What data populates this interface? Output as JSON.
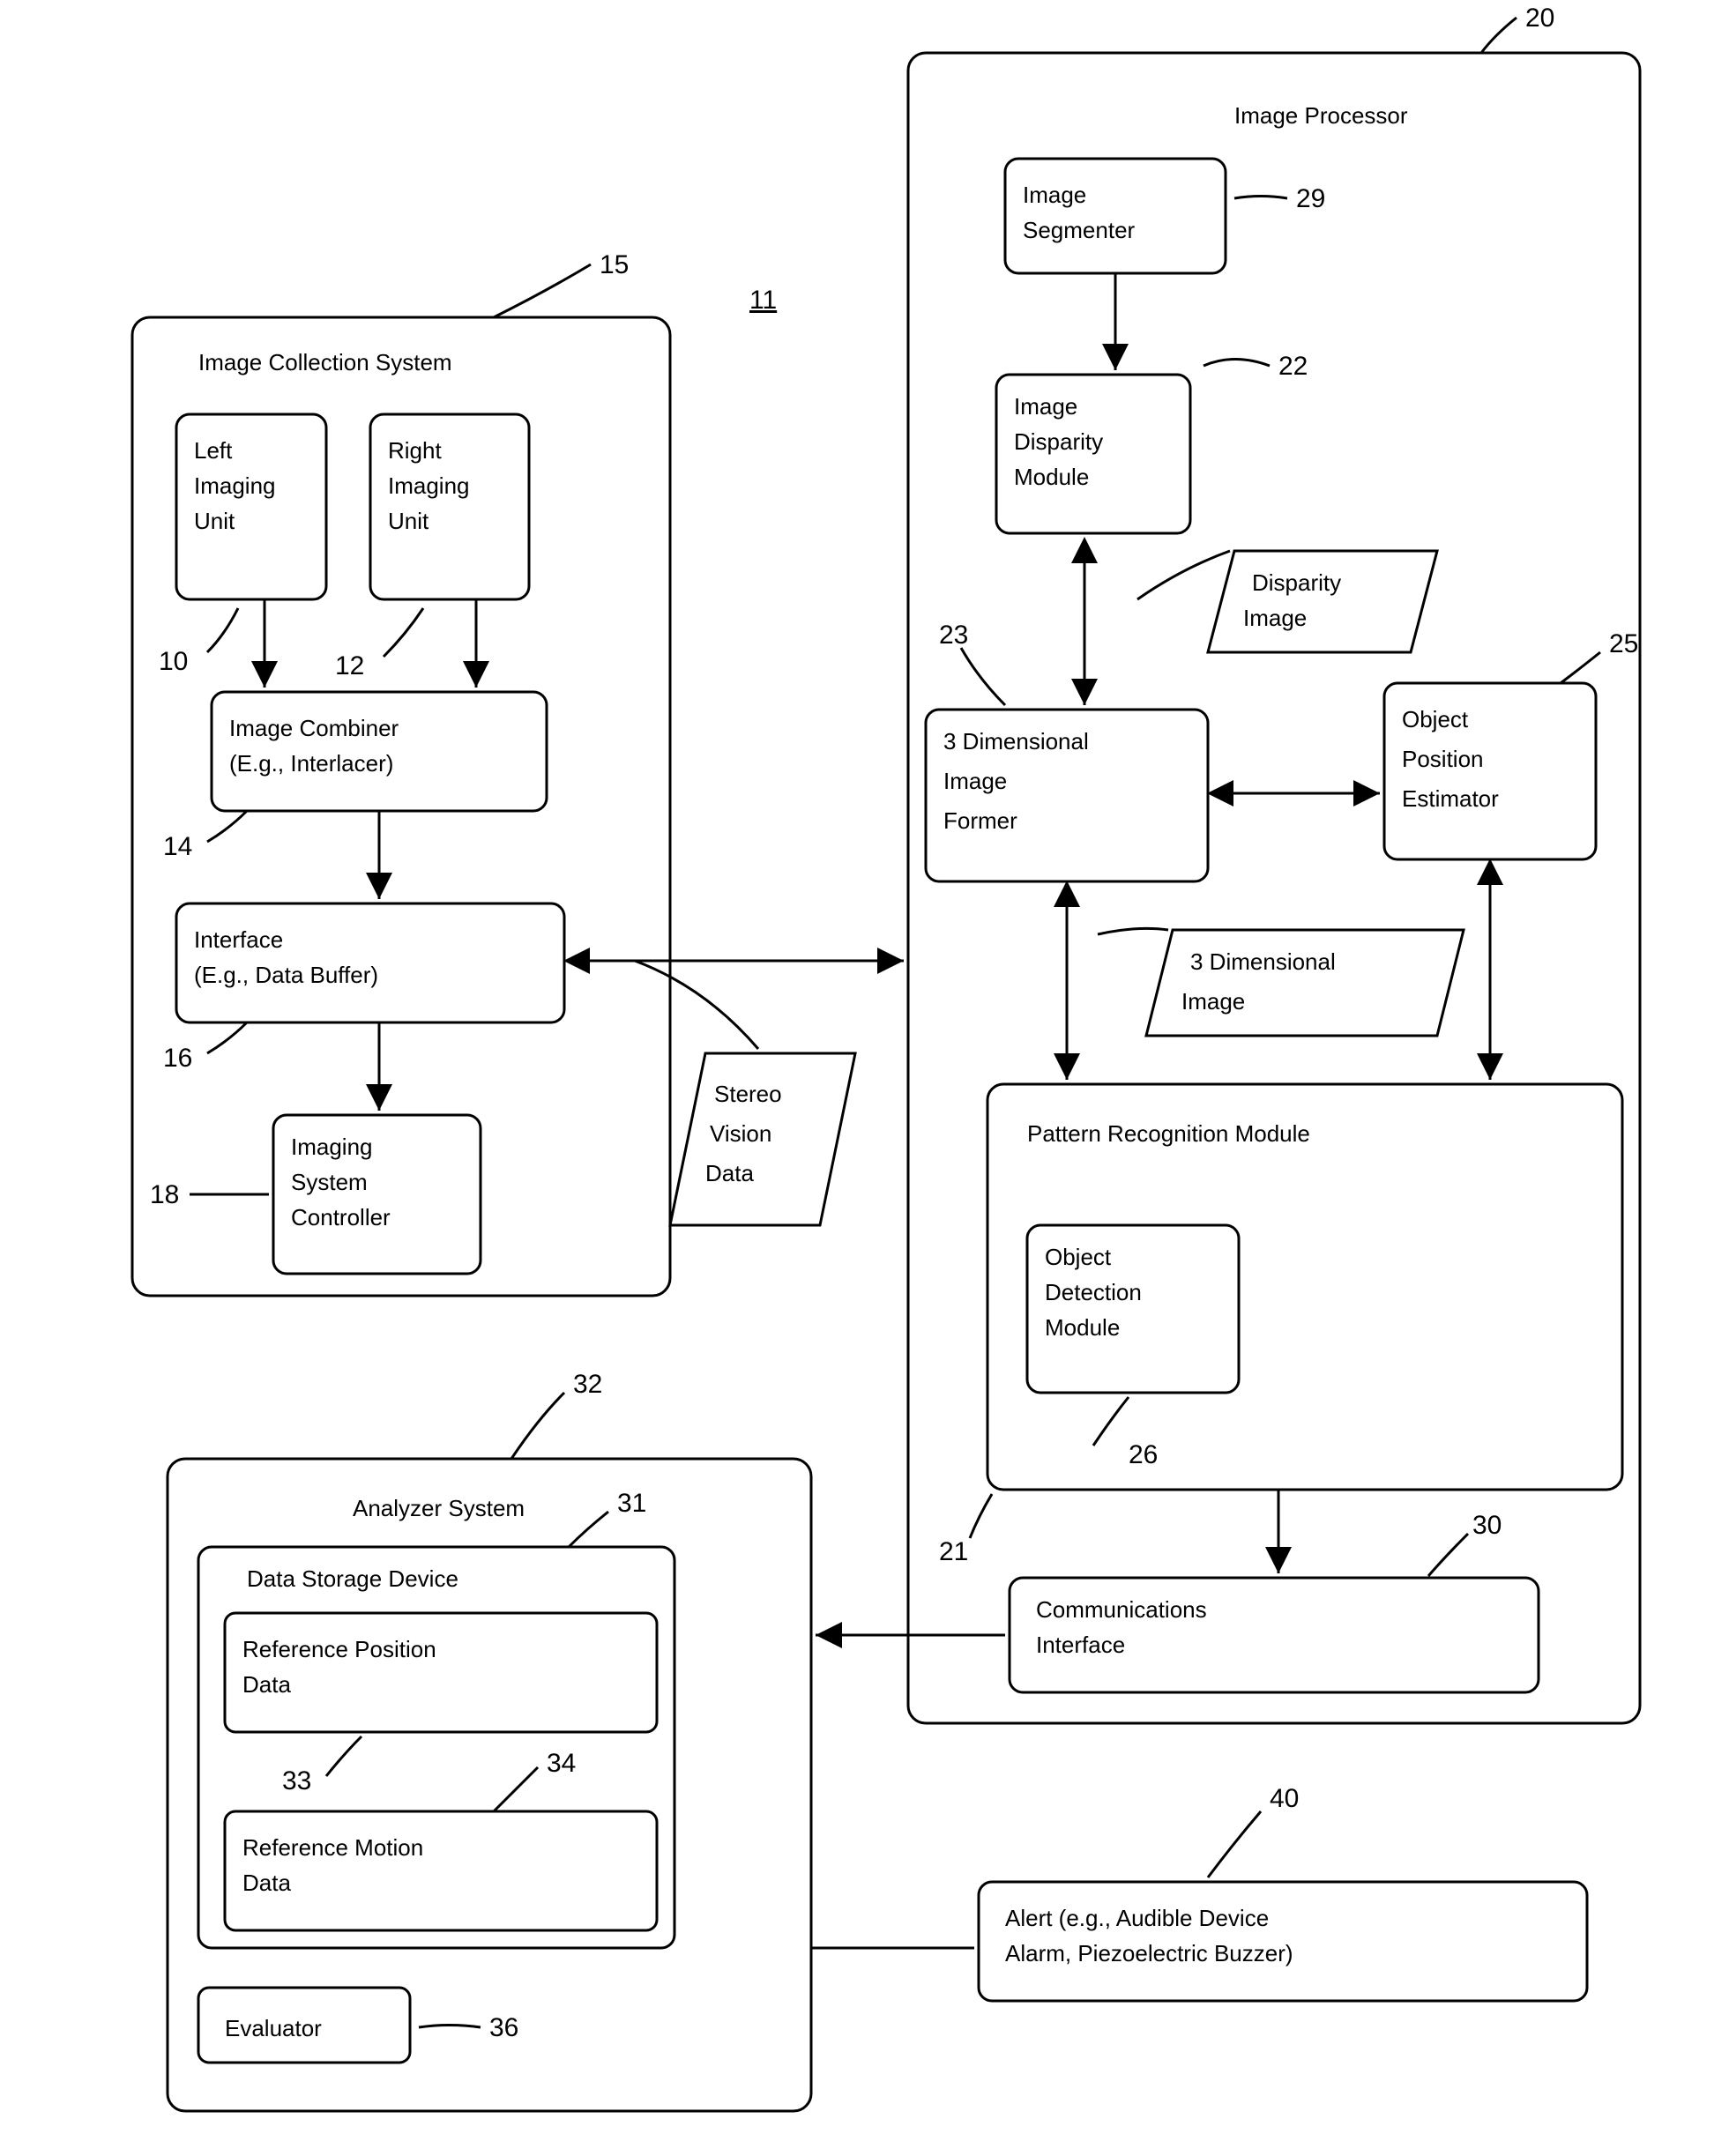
{
  "refs": {
    "r11": "11",
    "r15": "15",
    "r10": "10",
    "r12": "12",
    "r14": "14",
    "r16": "16",
    "r18": "18",
    "r20": "20",
    "r29": "29",
    "r22": "22",
    "r23": "23",
    "r25": "25",
    "r26": "26",
    "r21": "21",
    "r30": "30",
    "r31": "31",
    "r32": "32",
    "r33": "33",
    "r34": "34",
    "r36": "36",
    "r40": "40"
  },
  "labels": {
    "image_collection_system": "Image Collection System",
    "left_imaging_unit_l1": "Left",
    "left_imaging_unit_l2": "Imaging",
    "left_imaging_unit_l3": "Unit",
    "right_imaging_unit_l1": "Right",
    "right_imaging_unit_l2": "Imaging",
    "right_imaging_unit_l3": "Unit",
    "image_combiner_l1": "Image Combiner",
    "image_combiner_l2": "(E.g., Interlacer)",
    "interface_l1": "Interface",
    "interface_l2": "(E.g., Data Buffer)",
    "imaging_controller_l1": "Imaging",
    "imaging_controller_l2": "System",
    "imaging_controller_l3": "Controller",
    "stereo_vision_l1": "Stereo",
    "stereo_vision_l2": "Vision",
    "stereo_vision_l3": "Data",
    "image_processor": "Image Processor",
    "image_segmenter_l1": "Image",
    "image_segmenter_l2": "Segmenter",
    "image_disparity_l1": "Image",
    "image_disparity_l2": "Disparity",
    "image_disparity_l3": "Module",
    "disparity_image_l1": "Disparity",
    "disparity_image_l2": "Image",
    "three_d_former_l1": "3 Dimensional",
    "three_d_former_l2": "Image",
    "three_d_former_l3": "Former",
    "obj_pos_est_l1": "Object",
    "obj_pos_est_l2": "Position",
    "obj_pos_est_l3": "Estimator",
    "three_d_image_l1": "3 Dimensional",
    "three_d_image_l2": "Image",
    "pattern_recog": "Pattern Recognition Module",
    "obj_det_l1": "Object",
    "obj_det_l2": "Detection",
    "obj_det_l3": "Module",
    "comm_iface_l1": "Communications",
    "comm_iface_l2": "Interface",
    "analyzer_system": "Analyzer System",
    "data_storage": "Data Storage Device",
    "ref_pos_l1": "Reference Position",
    "ref_pos_l2": "Data",
    "ref_motion_l1": "Reference Motion",
    "ref_motion_l2": "Data",
    "evaluator": "Evaluator",
    "alert_l1": "Alert (e.g., Audible Device",
    "alert_l2": "Alarm, Piezoelectric Buzzer)"
  }
}
